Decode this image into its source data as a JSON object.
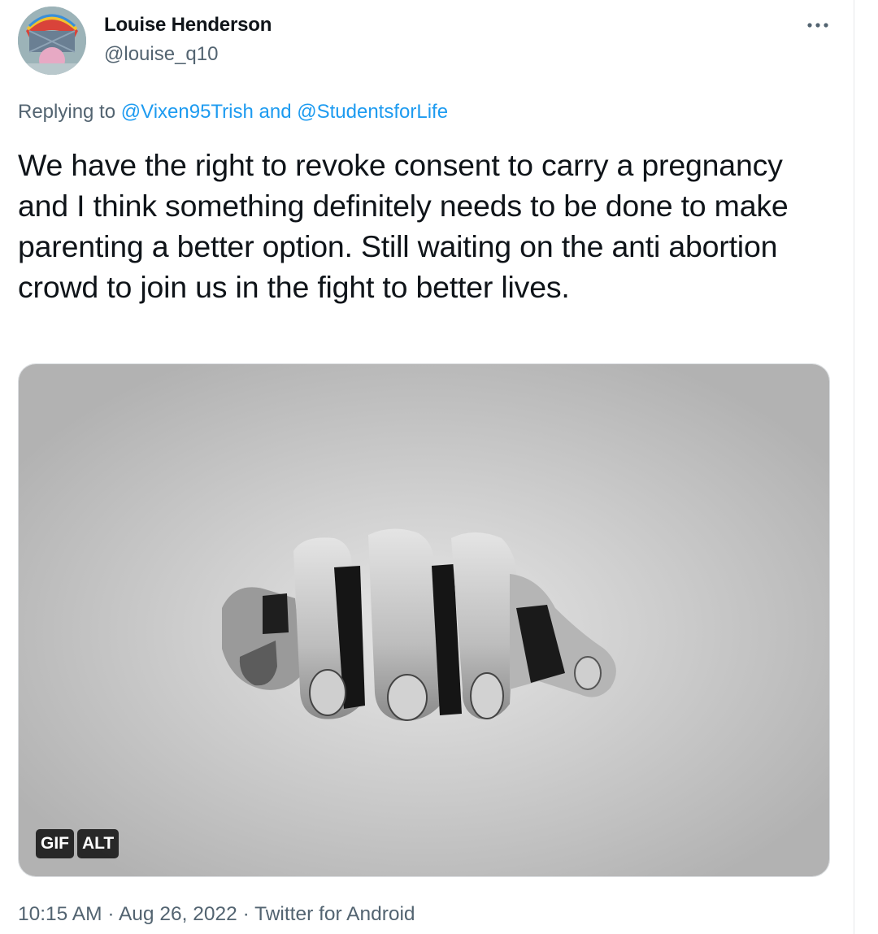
{
  "tweet": {
    "author_name": "Louise Henderson",
    "author_handle": "@louise_q10",
    "more_icon": "more-horizontal-icon",
    "replying_prefix": "Replying to",
    "replying_mention_1": "@Vixen95Trish",
    "replying_and": "and",
    "replying_mention_2": "@StudentsforLife",
    "text": "We have the right to revoke consent to carry a pregnancy and I think something definitely needs to be done to make parenting a better option. Still waiting on the anti abortion crowd to join us in the fight to better lives.",
    "media": {
      "gif_badge": "GIF",
      "alt_badge": "ALT"
    },
    "time": "10:15 AM",
    "separator": "·",
    "date": "Aug 26, 2022",
    "source": "Twitter for Android"
  },
  "colors": {
    "text": "#0f1419",
    "secondary": "#536471",
    "link": "#1d9bf0"
  }
}
